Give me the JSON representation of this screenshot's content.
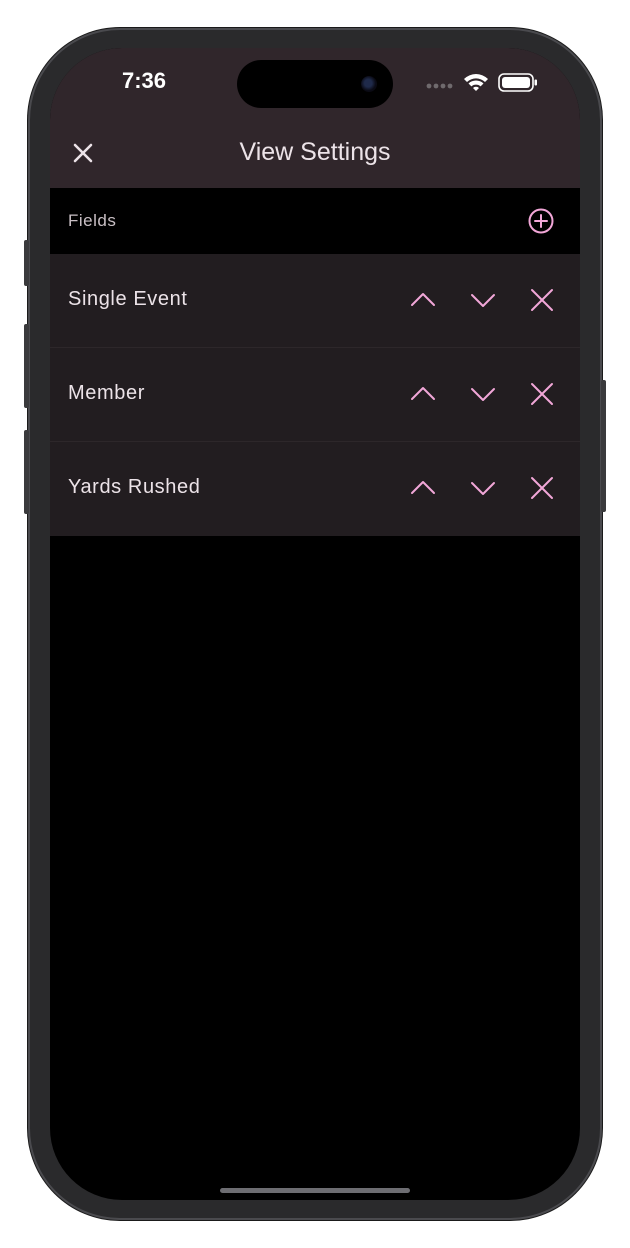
{
  "status_bar": {
    "time": "7:36",
    "icons": [
      "signal-dots-icon",
      "wifi-icon",
      "battery-icon"
    ]
  },
  "header": {
    "title": "View Settings",
    "close_icon": "close-icon"
  },
  "fields_section": {
    "label": "Fields",
    "add_icon": "add-circle-icon",
    "items": [
      {
        "label": "Single Event"
      },
      {
        "label": "Member"
      },
      {
        "label": "Yards Rushed"
      }
    ]
  },
  "colors": {
    "accent": "#f2a7d8",
    "header_bg": "#30262b",
    "row_bg": "#221d20",
    "background": "#000000",
    "text": "#ece3e8"
  }
}
